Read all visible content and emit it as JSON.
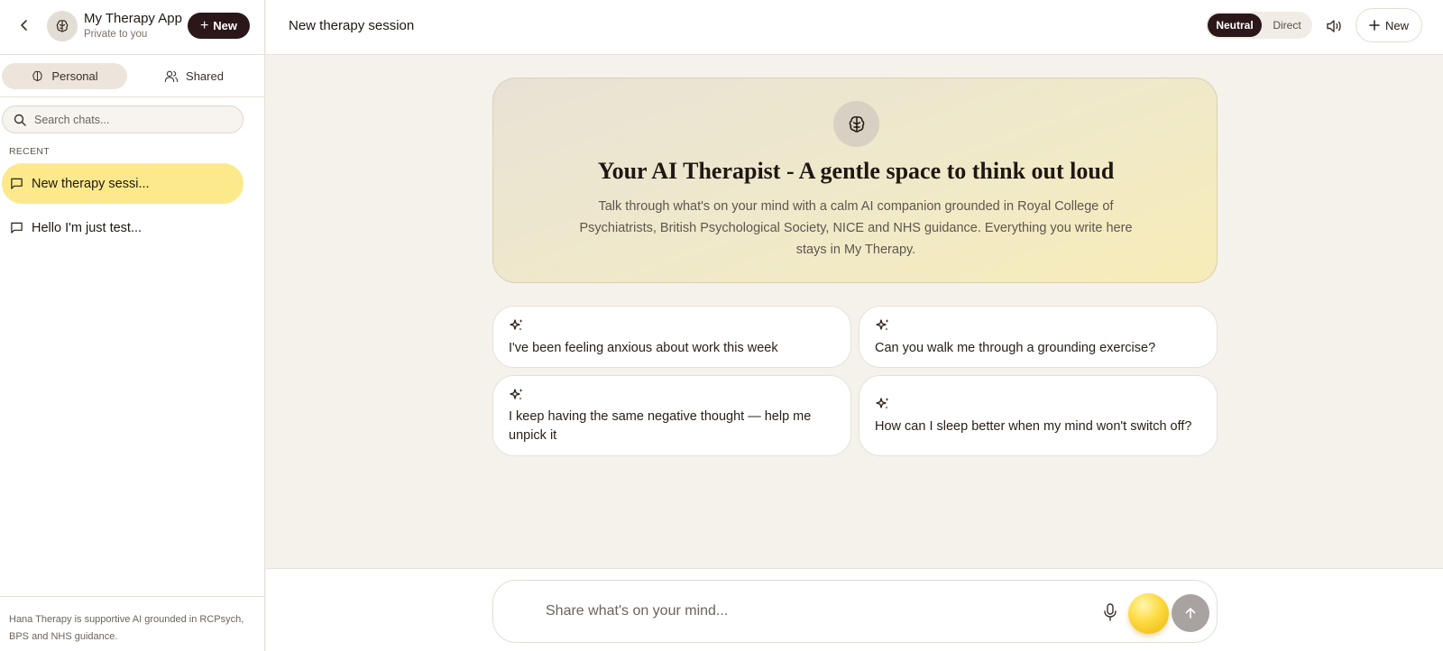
{
  "sidebar": {
    "app_title": "My Therapy App",
    "app_subtitle": "Private to you",
    "new_label": "New",
    "tabs": [
      {
        "label": "Personal"
      },
      {
        "label": "Shared"
      }
    ],
    "search_placeholder": "Search chats...",
    "recent_label": "RECENT",
    "chats": [
      {
        "label": "New therapy sessi...",
        "active": true
      },
      {
        "label": "Hello I'm just test..."
      }
    ],
    "footer_text": "Hana Therapy is supportive AI grounded in RCPsych, BPS and NHS guidance."
  },
  "header": {
    "session_title": "New therapy session",
    "tone_options": [
      "Neutral",
      "Direct"
    ],
    "tone_selected": "Neutral",
    "new_label": "New"
  },
  "hero": {
    "title": "Your AI Therapist - A gentle space to think out loud",
    "description": "Talk through what's on your mind with a calm AI companion grounded in Royal College of Psychiatrists, British Psychological Society, NICE and NHS guidance. Everything you write here stays in My Therapy."
  },
  "suggestions": [
    {
      "text": "I've been feeling anxious about work this week"
    },
    {
      "text": "Can you walk me through a grounding exercise?"
    },
    {
      "text": "I keep having the same negative thought — help me unpick it"
    },
    {
      "text": "How can I sleep better when my mind won't switch off?"
    }
  ],
  "composer": {
    "placeholder": "Share what's on your mind..."
  },
  "icons": {
    "back": "chevron-left-icon",
    "brain": "brain-icon",
    "users": "users-icon",
    "search": "search-icon",
    "chat": "message-square-icon",
    "speaker": "speaker-icon",
    "plus": "plus-icon",
    "sparkle": "sparkles-icon",
    "mic": "microphone-icon",
    "send": "arrow-up-icon"
  },
  "colors": {
    "accent_dark": "#2b1719",
    "active_chat": "#fce98c",
    "background": "#f5f2ec",
    "orb": "#fddd48"
  }
}
